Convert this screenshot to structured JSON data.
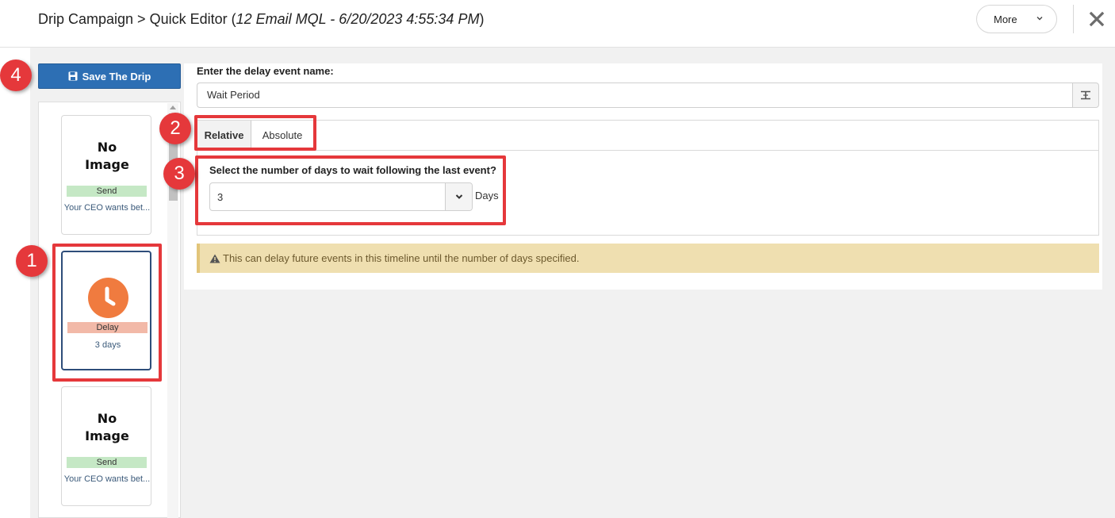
{
  "header": {
    "title_prefix": "Drip Campaign > Quick Editor (",
    "title_italic": "12 Email MQL - 6/20/2023 4:55:34 PM",
    "title_suffix": ")",
    "more_label": "More"
  },
  "sidebar": {
    "save_label": "Save The Drip",
    "cards": [
      {
        "image_line1": "No",
        "image_line2": "Image",
        "type": "Send",
        "subtitle": "Your CEO wants bet..."
      },
      {
        "icon": "clock-icon",
        "type": "Delay",
        "subtitle": "3 days"
      },
      {
        "image_line1": "No",
        "image_line2": "Image",
        "type": "Send",
        "subtitle": "Your CEO wants bet..."
      }
    ]
  },
  "editor": {
    "name_label": "Enter the delay event name:",
    "name_value": "Wait Period",
    "tabs": [
      {
        "label": "Relative",
        "active": true
      },
      {
        "label": "Absolute",
        "active": false
      }
    ],
    "question": "Select the number of days to wait following the last event?",
    "days_value": "3",
    "days_unit": "Days",
    "alert_text": "This can delay future events in this timeline until the number of days specified."
  },
  "callouts": [
    "1",
    "2",
    "3",
    "4"
  ],
  "colors": {
    "accent": "#2d6fb4",
    "callout": "#e5383b",
    "delay_icon": "#f07b3f",
    "send_badge": "#c5e8c5",
    "delay_badge": "#f2b9a8",
    "alert_bg": "#efdfb0"
  }
}
